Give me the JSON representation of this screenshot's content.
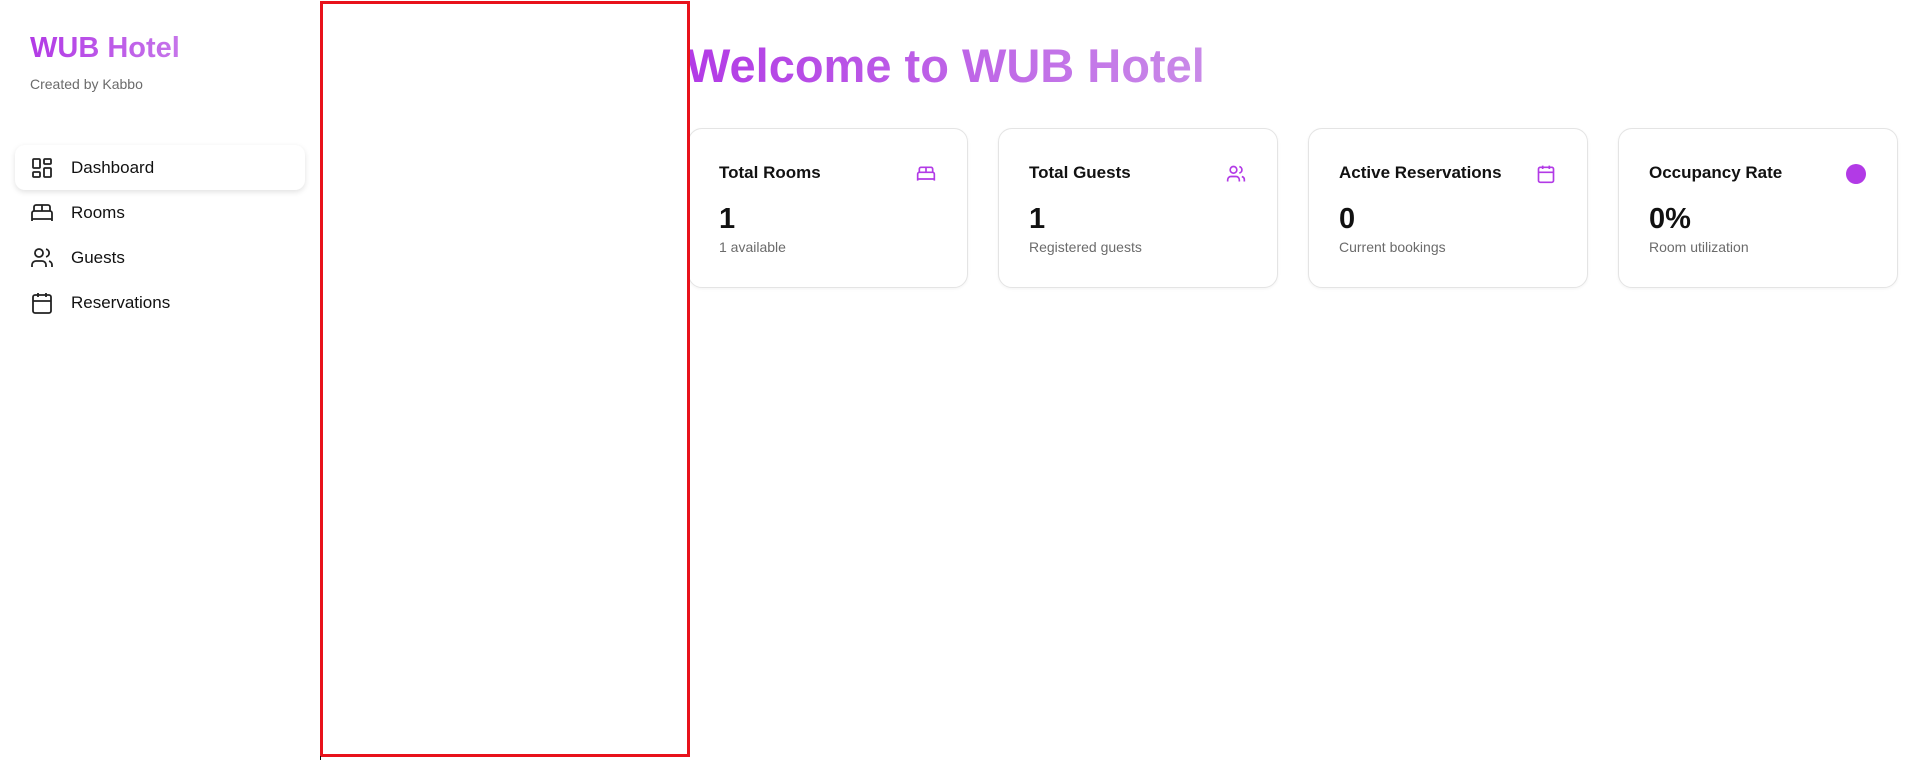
{
  "brand": {
    "title": "WUB Hotel",
    "subtitle": "Created by Kabbo"
  },
  "nav": {
    "items": [
      {
        "label": "Dashboard",
        "icon": "dashboard-icon",
        "active": true
      },
      {
        "label": "Rooms",
        "icon": "bed-icon",
        "active": false
      },
      {
        "label": "Guests",
        "icon": "users-icon",
        "active": false
      },
      {
        "label": "Reservations",
        "icon": "calendar-icon",
        "active": false
      }
    ]
  },
  "main": {
    "heading": "Welcome to WUB Hotel",
    "cards": [
      {
        "title": "Total Rooms",
        "value": "1",
        "subtitle": "1 available",
        "icon": "bed-icon"
      },
      {
        "title": "Total Guests",
        "value": "1",
        "subtitle": "Registered guests",
        "icon": "users-icon"
      },
      {
        "title": "Active Reservations",
        "value": "0",
        "subtitle": "Current bookings",
        "icon": "calendar-icon"
      },
      {
        "title": "Occupancy Rate",
        "value": "0%",
        "subtitle": "Room utilization",
        "icon": "dot-icon"
      }
    ]
  },
  "colors": {
    "accent": "#b23ae6",
    "overlay_border": "#e8121b"
  }
}
